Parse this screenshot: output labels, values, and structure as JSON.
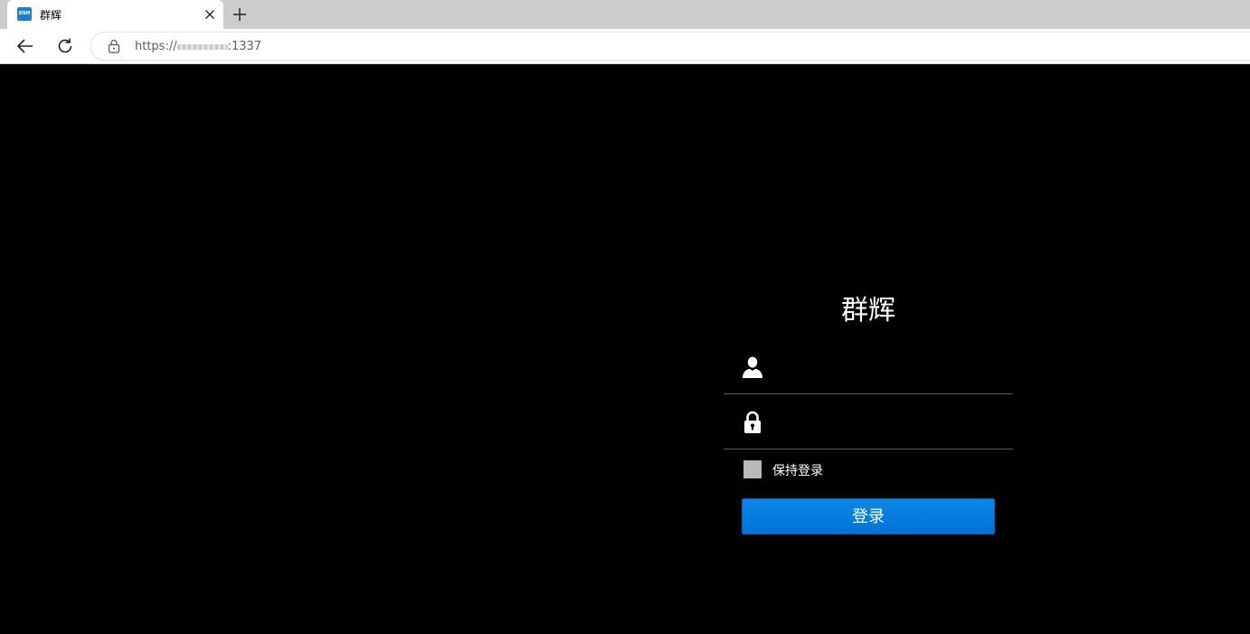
{
  "browser": {
    "tab": {
      "title": "群辉",
      "favicon_text": "DSM"
    },
    "address_bar": {
      "prefix": "https://",
      "suffix": ":1337"
    }
  },
  "login": {
    "title": "群辉",
    "username_placeholder": "",
    "password_placeholder": "",
    "remember_label": "保持登录",
    "remember_checked": false,
    "submit_label": "登录"
  },
  "icons": {
    "username": "user-icon",
    "password": "lock-icon"
  },
  "colors": {
    "page_background": "#000000",
    "button_blue": "#0a80e0",
    "checkbox_gray": "#b9b9b9"
  }
}
